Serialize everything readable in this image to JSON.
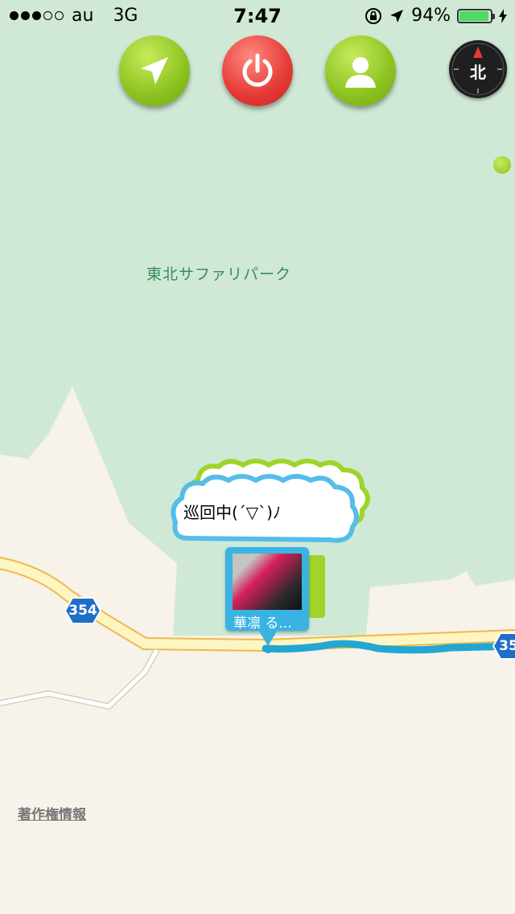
{
  "status_bar": {
    "carrier": "au",
    "network": "3G",
    "time": "7:47",
    "battery_percent": "94%",
    "battery_level": 0.94,
    "signal_bars_filled": 3,
    "signal_bars_total": 5
  },
  "toolbar": {
    "locate_icon": "location-arrow-icon",
    "power_icon": "power-icon",
    "profile_icon": "person-icon"
  },
  "compass": {
    "label": "北"
  },
  "map": {
    "place_label": "東北サファリパーク",
    "route_number": "354",
    "route_number_2": "35"
  },
  "bubble": {
    "text": "巡回中(´▽`)ﾉ"
  },
  "photo_pin": {
    "caption": "華凛 る..."
  },
  "copyright": "著作権情報",
  "colors": {
    "map_land": "#f7f2ea",
    "map_green": "#cfe9d6",
    "route_line": "#22a6d4",
    "road_yellow": "#fdf6c3",
    "accent_green": "#8cc21f",
    "accent_red": "#e53935",
    "bubble_blue": "#55bde8"
  }
}
